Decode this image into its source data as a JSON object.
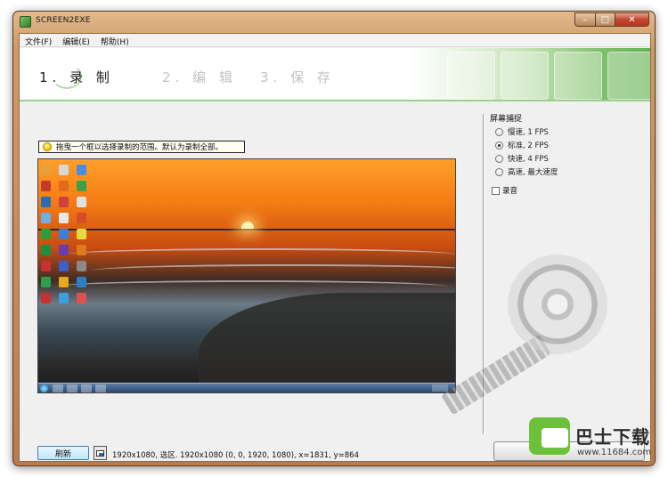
{
  "window": {
    "title": "SCREEN2EXE"
  },
  "menu": [
    {
      "label": "文件(F)"
    },
    {
      "label": "编辑(E)"
    },
    {
      "label": "帮助(H)"
    }
  ],
  "steps": [
    {
      "label": "1. 录 制",
      "active": true
    },
    {
      "label": "2. 编 辑",
      "active": false
    },
    {
      "label": "3. 保 存",
      "active": false
    }
  ],
  "hint": {
    "text": "拖曳一个框以选择录制的范围。默认为录制全部。",
    "icon": "lightbulb-icon"
  },
  "capture": {
    "title": "屏幕捕捉",
    "options": [
      {
        "label": "慢速, 1 FPS",
        "selected": false
      },
      {
        "label": "标准, 2 FPS",
        "selected": true
      },
      {
        "label": "快速, 4 FPS",
        "selected": false
      },
      {
        "label": "高速, 最大速度",
        "selected": false
      }
    ],
    "audio_label": "录音",
    "audio_checked": false
  },
  "toolbar": {
    "refresh_label": "刷新",
    "region_icon": "select-region-icon"
  },
  "status": {
    "text": "1920x1080, 选区. 1920x1080 (0, 0, 1920, 1080), x=1831, y=864"
  },
  "watermark": {
    "brand": "巴士下载",
    "url": "www.11684.com"
  },
  "colors": {
    "accent_green": "#65b256",
    "frame": "#c58b58"
  }
}
